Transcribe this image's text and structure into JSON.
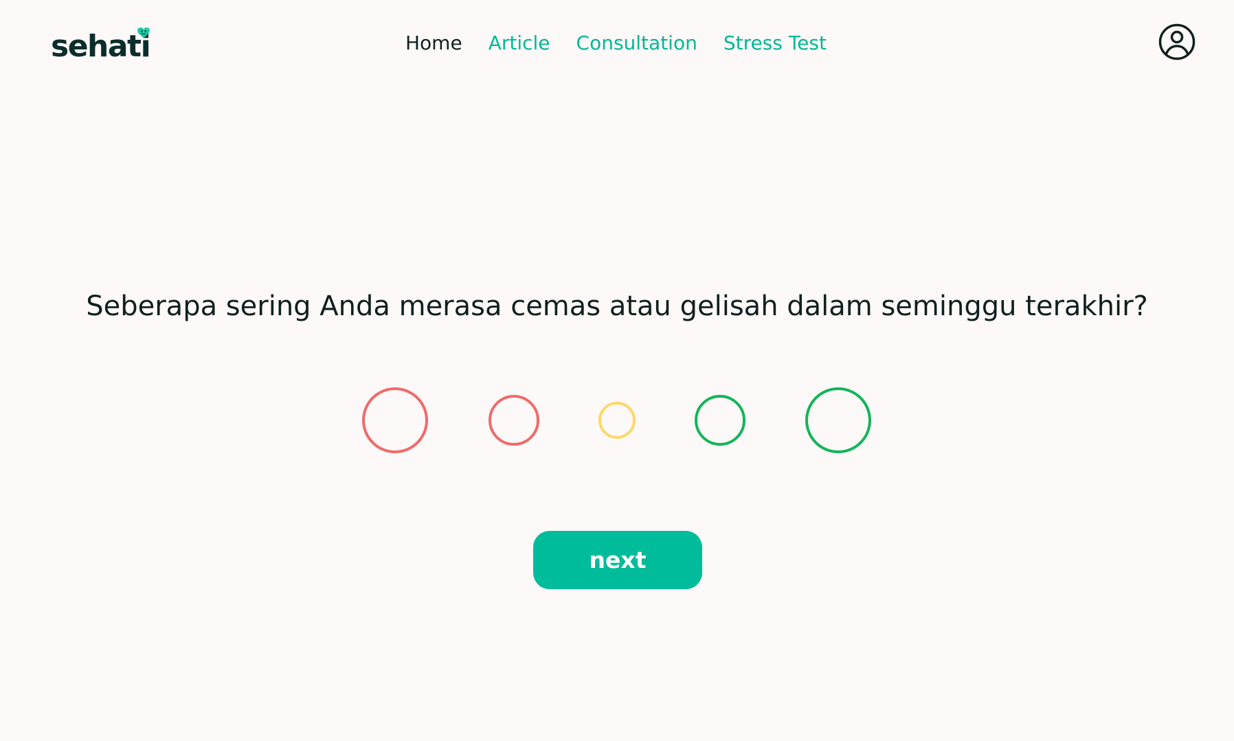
{
  "brand": {
    "name": "sehati",
    "accent_color": "#00b894",
    "dark_color": "#0b2e2d",
    "icon": "heart-icon"
  },
  "nav": {
    "items": [
      {
        "label": "Home",
        "active": true
      },
      {
        "label": "Article",
        "active": false
      },
      {
        "label": "Consultation",
        "active": false
      },
      {
        "label": "Stress Test",
        "active": false
      }
    ]
  },
  "profile": {
    "icon": "user-circle-icon"
  },
  "question": {
    "text": "Seberapa sering Anda merasa cemas atau gelisah dalam seminggu terakhir?"
  },
  "options": [
    {
      "color": "#f06a6a",
      "selected": false
    },
    {
      "color": "#f06a6a",
      "selected": false
    },
    {
      "color": "#fdd86a",
      "selected": false
    },
    {
      "color": "#13b559",
      "selected": false
    },
    {
      "color": "#13b559",
      "selected": false
    }
  ],
  "actions": {
    "next_label": "next",
    "button_color": "#00bc9b"
  }
}
